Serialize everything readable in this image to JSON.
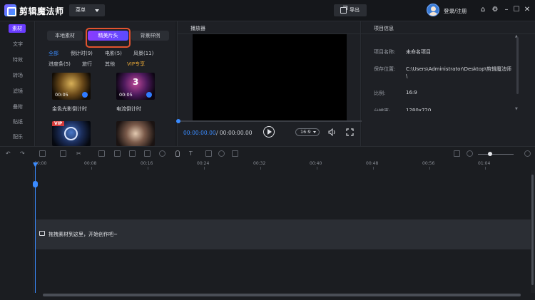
{
  "app": {
    "name": "剪辑魔法师"
  },
  "titlebar": {
    "menu_label": "菜单",
    "export_label": "导出",
    "login_label": "登录/注册"
  },
  "nav": {
    "items": [
      "素材",
      "文字",
      "特效",
      "转场",
      "滤镜",
      "叠附",
      "贴纸",
      "配乐"
    ]
  },
  "material": {
    "tabs": [
      "本地素材",
      "精美片头",
      "背景样例"
    ],
    "categories": [
      "全部",
      "倒计时(9)",
      "电影(5)",
      "风景(11)",
      "进度条(5)",
      "旅行",
      "其他",
      "VIP专享"
    ],
    "items": [
      {
        "label": "金色光影倒计时",
        "duration": "00:05"
      },
      {
        "label": "电流倒计时",
        "duration": "00:05"
      },
      {
        "label": "",
        "duration": "",
        "badge": "VIP"
      },
      {
        "label": "",
        "duration": ""
      }
    ]
  },
  "player": {
    "title": "播放器",
    "time_current": "00:00:00.00",
    "time_total": "/ 00:00:00.00",
    "ratio": "16:9"
  },
  "project": {
    "title": "项目信息",
    "rows": [
      {
        "label": "项目名称:",
        "value": "未命名项目"
      },
      {
        "label": "保存位置:",
        "value": "C:\\Users\\Administrator\\Desktop\\剪辑魔法师",
        "value2": "\\"
      },
      {
        "label": "比例:",
        "value": "16:9"
      },
      {
        "label": "分辨率:",
        "value": "1280x720"
      }
    ]
  },
  "timeline": {
    "ticks": [
      "00:00",
      "00:08",
      "00:16",
      "00:24",
      "00:32",
      "00:40",
      "00:48",
      "00:56",
      "01:04"
    ],
    "drop_hint": "拖拽素材到这里，开始创作吧~"
  },
  "colors": {
    "accent": "#3a8bff",
    "brand_purple": "#6a3cff",
    "highlight": "#e2532f",
    "vip": "#e5a637"
  }
}
